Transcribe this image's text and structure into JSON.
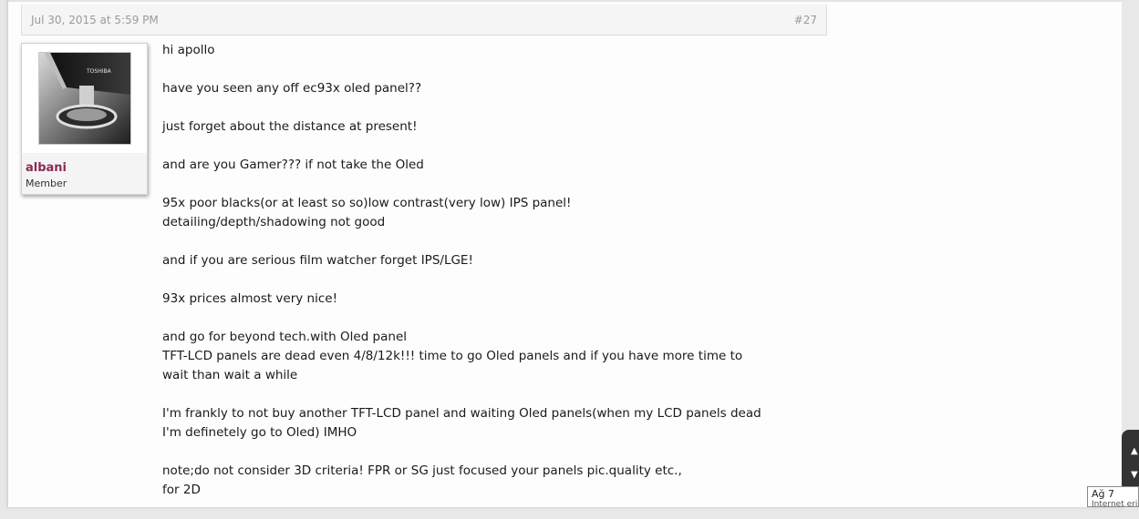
{
  "post": {
    "date": "Jul 30, 2015 at 5:59 PM",
    "number": "#27"
  },
  "user": {
    "name": "albani",
    "title": "Member",
    "avatar_brand": "TOSHIBA"
  },
  "message": {
    "paragraphs": [
      "hi apollo",
      "have you seen any off ec93x oled panel??",
      "just forget about the distance at present!",
      "and are you Gamer??? if not take the Oled",
      "95x poor blacks(or at least so so)low contrast(very low) IPS panel!\ndetailing/depth/shadowing not good",
      "and if you are serious film watcher forget IPS/LGE!",
      "93x prices almost very nice!",
      "and go for beyond tech.with Oled panel\nTFT-LCD panels are dead even 4/8/12k!!! time to go Oled panels and if you have more time to\nwait than wait a while",
      "I'm frankly to not buy another TFT-LCD panel and waiting Oled panels(when my LCD panels dead\nI'm definetely go to Oled) IMHO",
      "note;do not consider 3D criteria! FPR or SG just focused your panels pic.quality etc.,\nfor 2D"
    ]
  },
  "system": {
    "network_label": "Ağ 7",
    "network_status": "Internet erişimi"
  },
  "colors": {
    "username": "#8c2a52",
    "header_bg": "#f5f5f5",
    "meta_text": "#9a9a9a"
  }
}
